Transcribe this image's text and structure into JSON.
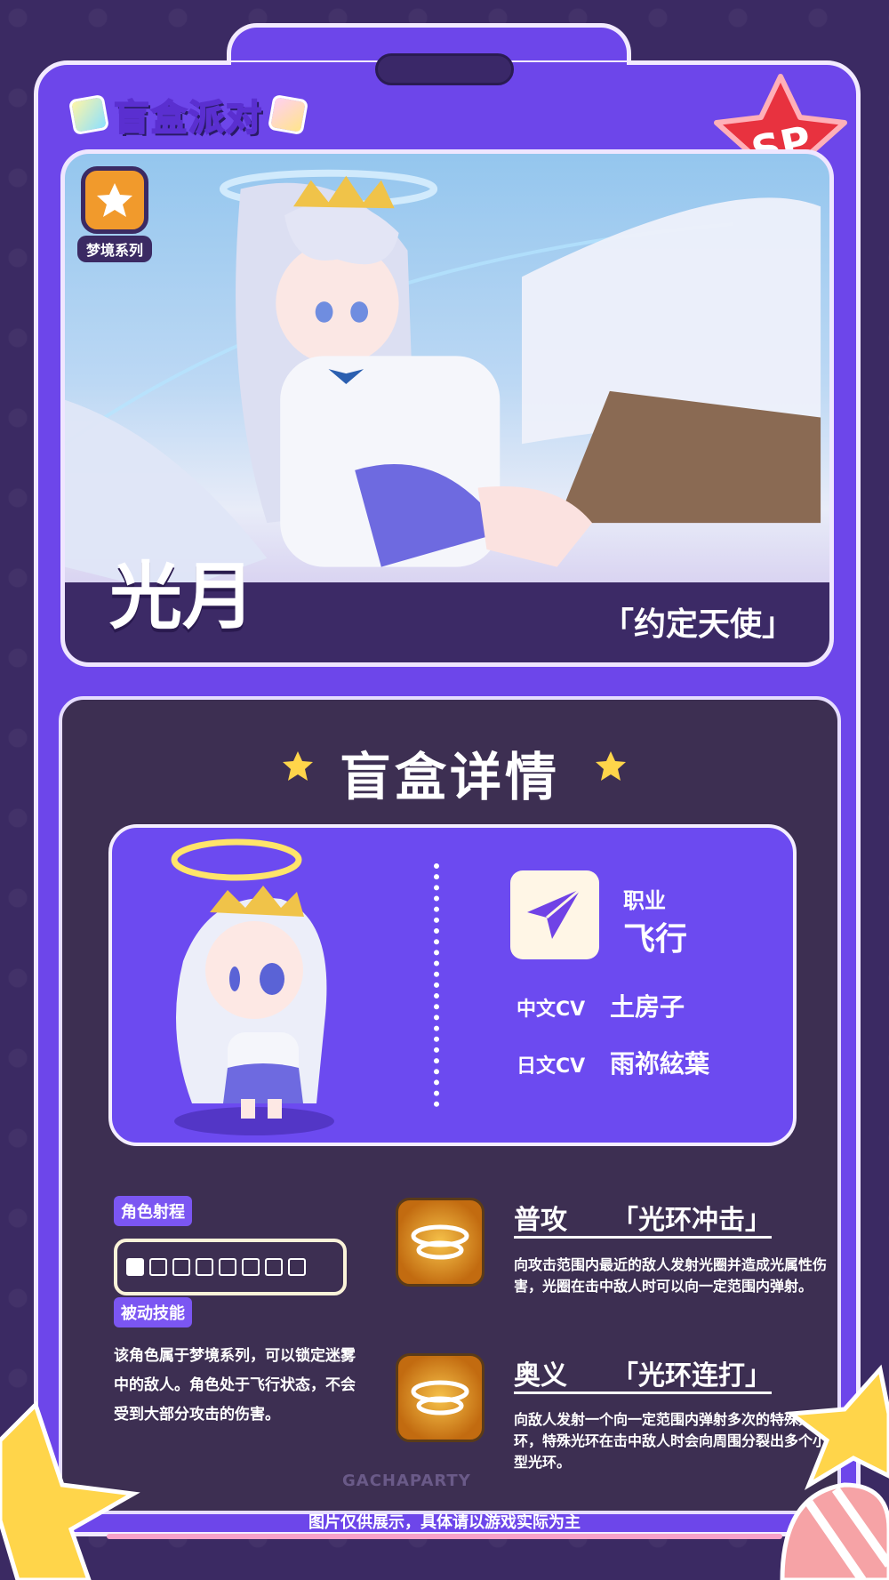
{
  "header": {
    "logo_text": "盲盒派对",
    "rarity_badge": "SP"
  },
  "hero": {
    "series_label": "梦境系列",
    "name": "光月",
    "title": "「约定天使」"
  },
  "details": {
    "section_title": "盲盒详情",
    "class_label": "职业",
    "class_value": "飞行",
    "cv": [
      {
        "label": "中文CV",
        "value": "土房子"
      },
      {
        "label": "日文CV",
        "value": "雨祢絃葉"
      }
    ],
    "range": {
      "label": "角色射程",
      "level": 1,
      "max": 8
    },
    "passive": {
      "label": "被动技能",
      "text": "该角色属于梦境系列，可以锁定迷雾中的敌人。角色处于飞行状态，不会受到大部分攻击的伤害。"
    },
    "skills": [
      {
        "type": "普攻",
        "name": "「光环冲击」",
        "desc": "向攻击范围内最近的敌人发射光圈并造成光属性伤害，光圈在击中敌人时可以向一定范围内弹射。"
      },
      {
        "type": "奥义",
        "name": "「光环连打」",
        "desc": "向敌人发射一个向一定范围内弹射多次的特殊光环，特殊光环在击中敌人时会向周围分裂出多个小型光环。"
      }
    ],
    "watermark": "GACHAPARTY"
  },
  "footer": {
    "note": "图片仅供展示，具体请以游戏实际为主"
  },
  "colors": {
    "card": "#6d46ea",
    "bg": "#3b2a63",
    "panel": "#3d2f52",
    "accent_pink": "#f7a1c9",
    "star": "#ffd54a"
  }
}
